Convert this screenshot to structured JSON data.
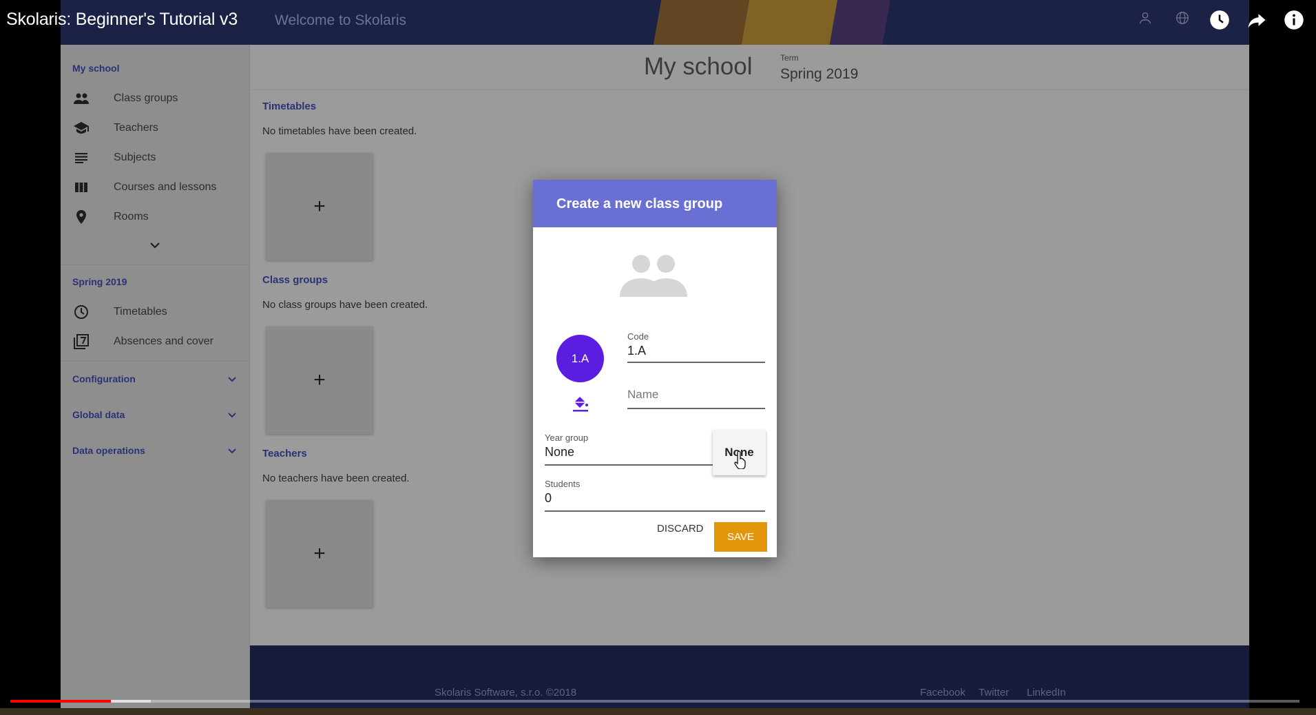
{
  "video": {
    "title": "Skolaris: Beginner's Tutorial v3",
    "progress_fraction": 0.078,
    "buffered_fraction": 0.109,
    "icons": [
      "account-icon",
      "globe-icon",
      "watch-later-icon",
      "share-icon",
      "info-icon"
    ]
  },
  "app": {
    "header_title": "Welcome to Skolaris"
  },
  "sidebar": {
    "my_school_heading": "My school",
    "my_school_items": [
      {
        "label": "Class groups",
        "icon": "people-icon"
      },
      {
        "label": "Teachers",
        "icon": "graduation-cap-icon"
      },
      {
        "label": "Subjects",
        "icon": "lines-icon"
      },
      {
        "label": "Courses and lessons",
        "icon": "columns-icon"
      },
      {
        "label": "Rooms",
        "icon": "location-pin-icon"
      }
    ],
    "term_heading": "Spring 2019",
    "term_items": [
      {
        "label": "Timetables",
        "icon": "clock-icon"
      },
      {
        "label": "Absences and cover",
        "icon": "filter-7-icon"
      }
    ],
    "configuration": "Configuration",
    "global_data": "Global data",
    "data_operations": "Data operations"
  },
  "main": {
    "page_title": "My school",
    "term_label": "Term",
    "term_value": "Spring 2019",
    "sections": [
      {
        "title": "Timetables",
        "empty": "No timetables have been created.",
        "add": "+"
      },
      {
        "title": "Class groups",
        "empty": "No class groups have been created.",
        "add": "+"
      },
      {
        "title": "Teachers",
        "empty": "No teachers have been created.",
        "add": "+"
      }
    ]
  },
  "footer": {
    "copyright": "Skolaris Software, s.r.o. ©2018",
    "links": [
      "Facebook",
      "Twitter",
      "LinkedIn"
    ]
  },
  "dialog": {
    "title": "Create a new class group",
    "avatar_text": "1.A",
    "avatar_color": "#5b1de0",
    "code_label": "Code",
    "code_value": "1.A",
    "name_placeholder": "Name",
    "year_group_label": "Year group",
    "year_group_value": "None",
    "year_group_option": "None",
    "students_label": "Students",
    "students_value": "0",
    "discard": "DISCARD",
    "save": "SAVE",
    "save_color": "#e3950b",
    "header_color": "#6a6fd3"
  }
}
